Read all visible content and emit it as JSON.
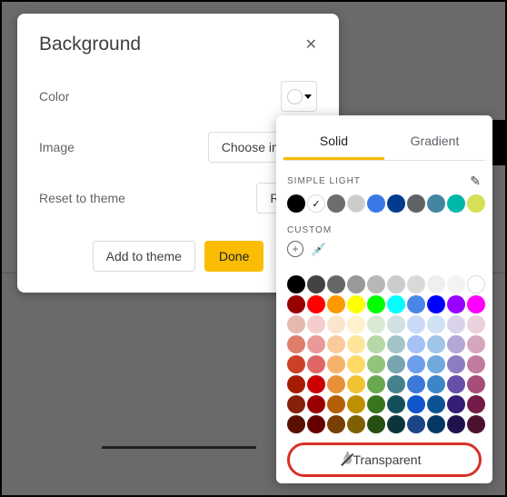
{
  "dialog": {
    "title": "Background",
    "rows": {
      "color_label": "Color",
      "image_label": "Image",
      "image_button": "Choose image",
      "reset_label": "Reset to theme",
      "reset_button": "Reset"
    },
    "actions": {
      "add": "Add to theme",
      "done": "Done"
    }
  },
  "picker": {
    "tabs": {
      "solid": "Solid",
      "gradient": "Gradient"
    },
    "sections": {
      "simple_light": "SIMPLE LIGHT",
      "custom": "CUSTOM"
    },
    "simple_light_colors": [
      {
        "c": "#000000"
      },
      {
        "c": "#ffffff",
        "selected": true,
        "border": true
      },
      {
        "c": "#6d6d6d"
      },
      {
        "c": "#cccccc",
        "border": true
      },
      {
        "c": "#3b78e7"
      },
      {
        "c": "#003b8e"
      },
      {
        "c": "#5f6368"
      },
      {
        "c": "#4285a3"
      },
      {
        "c": "#00b8a9"
      },
      {
        "c": "#d4e157"
      }
    ],
    "grid_colors": [
      "#000000",
      "#434343",
      "#666666",
      "#999999",
      "#b7b7b7",
      "#cccccc",
      "#d9d9d9",
      "#efefef",
      "#f3f3f3",
      "#ffffff",
      "#980000",
      "#ff0000",
      "#ff9900",
      "#ffff00",
      "#00ff00",
      "#00ffff",
      "#4a86e8",
      "#0000ff",
      "#9900ff",
      "#ff00ff",
      "#e6b8af",
      "#f4cccc",
      "#fce5cd",
      "#fff2cc",
      "#d9ead3",
      "#d0e0e3",
      "#c9daf8",
      "#cfe2f3",
      "#d9d2e9",
      "#ead1dc",
      "#dd7e6b",
      "#ea9999",
      "#f9cb9c",
      "#ffe599",
      "#b6d7a8",
      "#a2c4c9",
      "#a4c2f4",
      "#9fc5e8",
      "#b4a7d6",
      "#d5a6bd",
      "#cc4125",
      "#e06666",
      "#f6b26b",
      "#ffd966",
      "#93c47d",
      "#76a5af",
      "#6d9eeb",
      "#6fa8dc",
      "#8e7cc3",
      "#c27ba0",
      "#a61c00",
      "#cc0000",
      "#e69138",
      "#f1c232",
      "#6aa84f",
      "#45818e",
      "#3c78d8",
      "#3d85c6",
      "#674ea7",
      "#a64d79",
      "#85200c",
      "#990000",
      "#b45f06",
      "#bf9000",
      "#38761d",
      "#134f5c",
      "#1155cc",
      "#0b5394",
      "#351c75",
      "#741b47",
      "#5b0f00",
      "#660000",
      "#783f04",
      "#7f6000",
      "#274e13",
      "#0c343d",
      "#1c4587",
      "#073763",
      "#20124d",
      "#4c1130"
    ],
    "transparent_label": "Transparent"
  }
}
